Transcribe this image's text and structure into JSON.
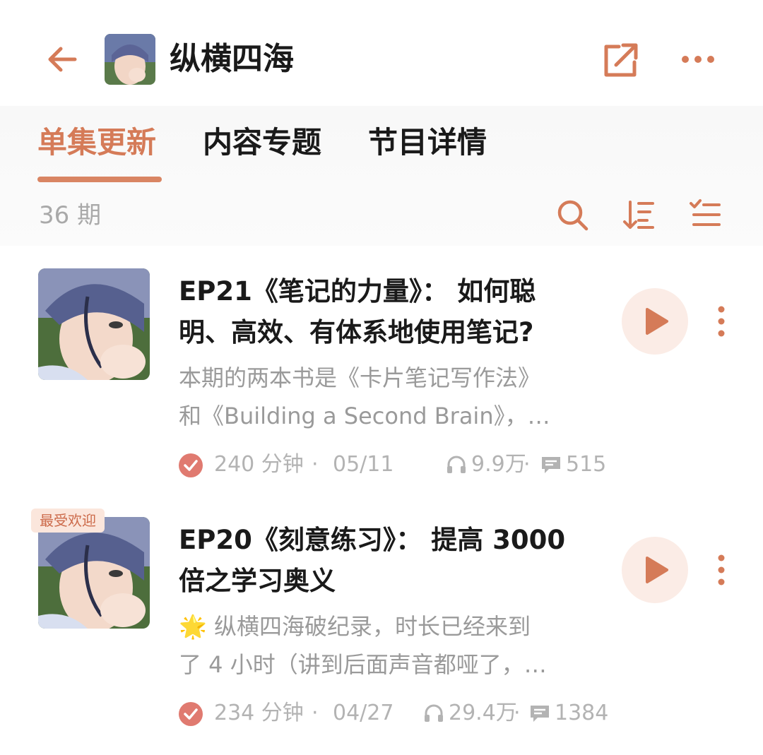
{
  "colors": {
    "accent": "#d57b58",
    "muted": "#a9a9a9",
    "badge_bg": "#fbe6dc"
  },
  "header": {
    "title": "纵横四海",
    "back_icon": "arrow-left-icon",
    "share_icon": "share-icon",
    "more_icon": "more-horizontal-icon"
  },
  "tabs": [
    {
      "label": "单集更新",
      "active": true
    },
    {
      "label": "内容专题",
      "active": false
    },
    {
      "label": "节目详情",
      "active": false
    }
  ],
  "toolbar": {
    "count": "36 期",
    "icons": [
      "search-icon",
      "sort-icon",
      "multi-select-icon"
    ]
  },
  "episodes": [
    {
      "title": "EP21《笔记的力量》： 如何聪明、高效、有体系地使用笔记?",
      "title_line1": "EP21《笔记的力量》： 如何聪",
      "title_line2": "明、高效、有体系地使用笔记?",
      "desc": "本期的两本书是《卡片笔记写作法》和《Building a Second Brain》，…",
      "desc_line1": "本期的两本书是《卡片笔记写作法》",
      "desc_line2": "和《Building a Second Brain》，…",
      "duration": "240 分钟",
      "date": "05/11",
      "plays": "9.9万",
      "comments": "515",
      "badge": ""
    },
    {
      "title": "EP20《刻意练习》： 提高 3000 倍之学习奥义",
      "title_line1": "EP20《刻意练习》： 提高 3000",
      "title_line2": "倍之学习奥义",
      "desc": "🌟 纵横四海破纪录，时长已经来到了 4 小时（讲到后面声音都哑了，…",
      "desc_line1": "🌟 纵横四海破纪录，时长已经来到",
      "desc_line2": "了 4 小时（讲到后面声音都哑了，…",
      "duration": "234 分钟",
      "date": "04/27",
      "plays": "29.4万",
      "comments": "1384",
      "badge": "最受欢迎"
    }
  ],
  "sep": "·"
}
